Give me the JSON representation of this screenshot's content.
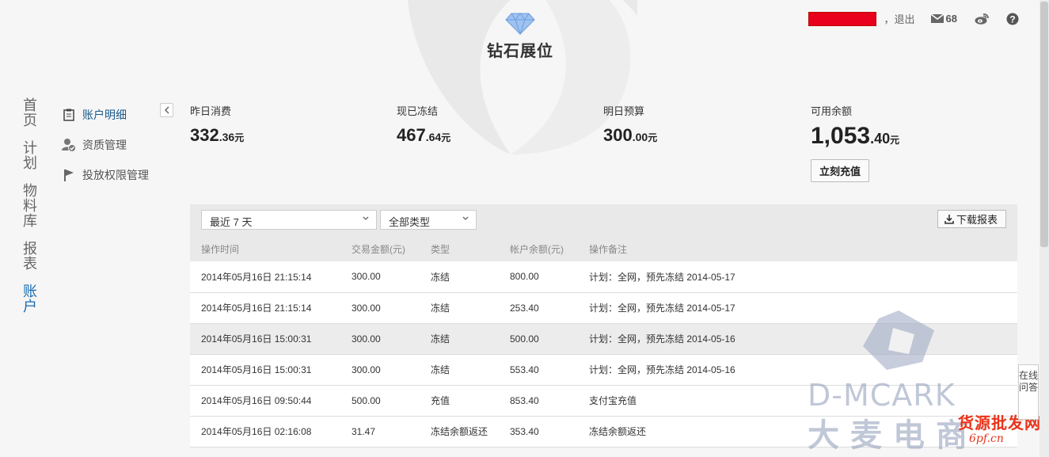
{
  "header": {
    "logo_text": "钻石展位",
    "logout": "，退出",
    "mail_count": "68",
    "icons": [
      "diamond-icon",
      "mail-icon",
      "weibo-icon",
      "help-icon"
    ]
  },
  "left_nav": {
    "items": [
      {
        "label": "首页",
        "active": false
      },
      {
        "label": "计划",
        "active": false
      },
      {
        "label": "物料库",
        "active": false
      },
      {
        "label": "报表",
        "active": false
      },
      {
        "label": "账户",
        "active": true
      }
    ]
  },
  "sub_nav": {
    "items": [
      {
        "label": "账户明细",
        "icon": "clipboard-icon",
        "active": true
      },
      {
        "label": "资质管理",
        "icon": "user-verified-icon",
        "active": false
      },
      {
        "label": "投放权限管理",
        "icon": "flag-icon",
        "active": false
      }
    ]
  },
  "stats": {
    "yesterday": {
      "label": "昨日消费",
      "int": "332",
      "dec": ".36",
      "unit": "元"
    },
    "frozen": {
      "label": "现已冻结",
      "int": "467",
      "dec": ".64",
      "unit": "元"
    },
    "budget": {
      "label": "明日预算",
      "int": "300",
      "dec": ".00",
      "unit": "元"
    },
    "available": {
      "label": "可用余额",
      "int": "1,053",
      "dec": ".40",
      "unit": "元",
      "button": "立刻充值"
    }
  },
  "toolbar": {
    "range_select": "最近 7 天",
    "type_select": "全部类型",
    "download": "下载报表"
  },
  "table": {
    "headers": [
      "操作时间",
      "交易金额(元)",
      "类型",
      "帐户余额(元)",
      "操作备注"
    ],
    "rows": [
      [
        "2014年05月16日 21:15:14",
        "300.00",
        "冻结",
        "800.00",
        "计划：全网，预先冻结 2014-05-17"
      ],
      [
        "2014年05月16日 21:15:14",
        "300.00",
        "冻结",
        "253.40",
        "计划：全网，预先冻结 2014-05-17"
      ],
      [
        "2014年05月16日 15:00:31",
        "300.00",
        "冻结",
        "500.00",
        "计划：全网，预先冻结 2014-05-16"
      ],
      [
        "2014年05月16日 15:00:31",
        "300.00",
        "冻结",
        "553.40",
        "计划：全网，预先冻结 2014-05-16"
      ],
      [
        "2014年05月16日 09:50:44",
        "500.00",
        "充值",
        "853.40",
        "支付宝充值"
      ],
      [
        "2014年05月16日 02:16:08",
        "31.47",
        "冻结余额返还",
        "353.40",
        "冻结余额返还"
      ]
    ]
  },
  "online_chat": "在线问答",
  "watermark": {
    "en": "D-MCARK",
    "cn": "大麦电商",
    "red": "货源批发网",
    "url": "6pf.cn"
  },
  "colors": {
    "accent": "#1b6bb0",
    "username_redaction": "#e8001c",
    "row_highlight": "#ececec"
  }
}
